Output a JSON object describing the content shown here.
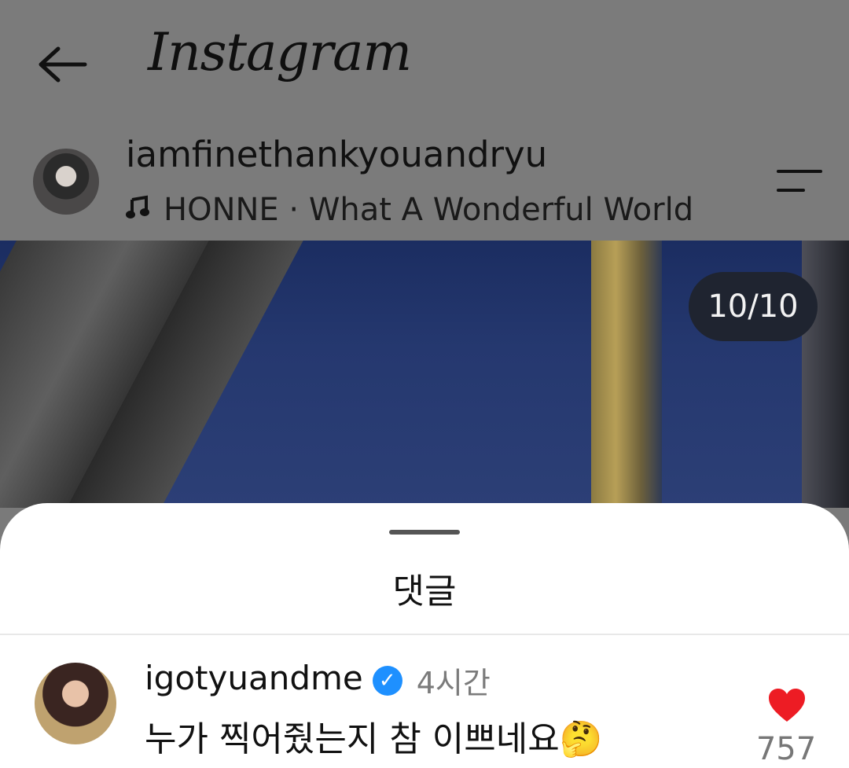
{
  "header": {
    "logo": "Instagram",
    "username": "iamfinethankyouandryu",
    "music": "HONNE · What A Wonderful World"
  },
  "post": {
    "image_counter": "10/10"
  },
  "comments_sheet": {
    "title": "댓글",
    "comments": [
      {
        "username": "igotyuandme",
        "verified": true,
        "time": "4시간",
        "text": "누가 찍어줬는지 참 이쁘네요🤔",
        "likes": "757",
        "liked": true
      }
    ]
  },
  "colors": {
    "overlay_gray": "#7b7b7b",
    "verified_blue": "#1e90ff",
    "like_red": "#ed1c24",
    "text": "#111111",
    "muted": "#7b7b7b"
  },
  "icons": [
    "back-arrow-icon",
    "music-note-icon",
    "menu-icon",
    "verified-badge-icon",
    "heart-icon"
  ]
}
